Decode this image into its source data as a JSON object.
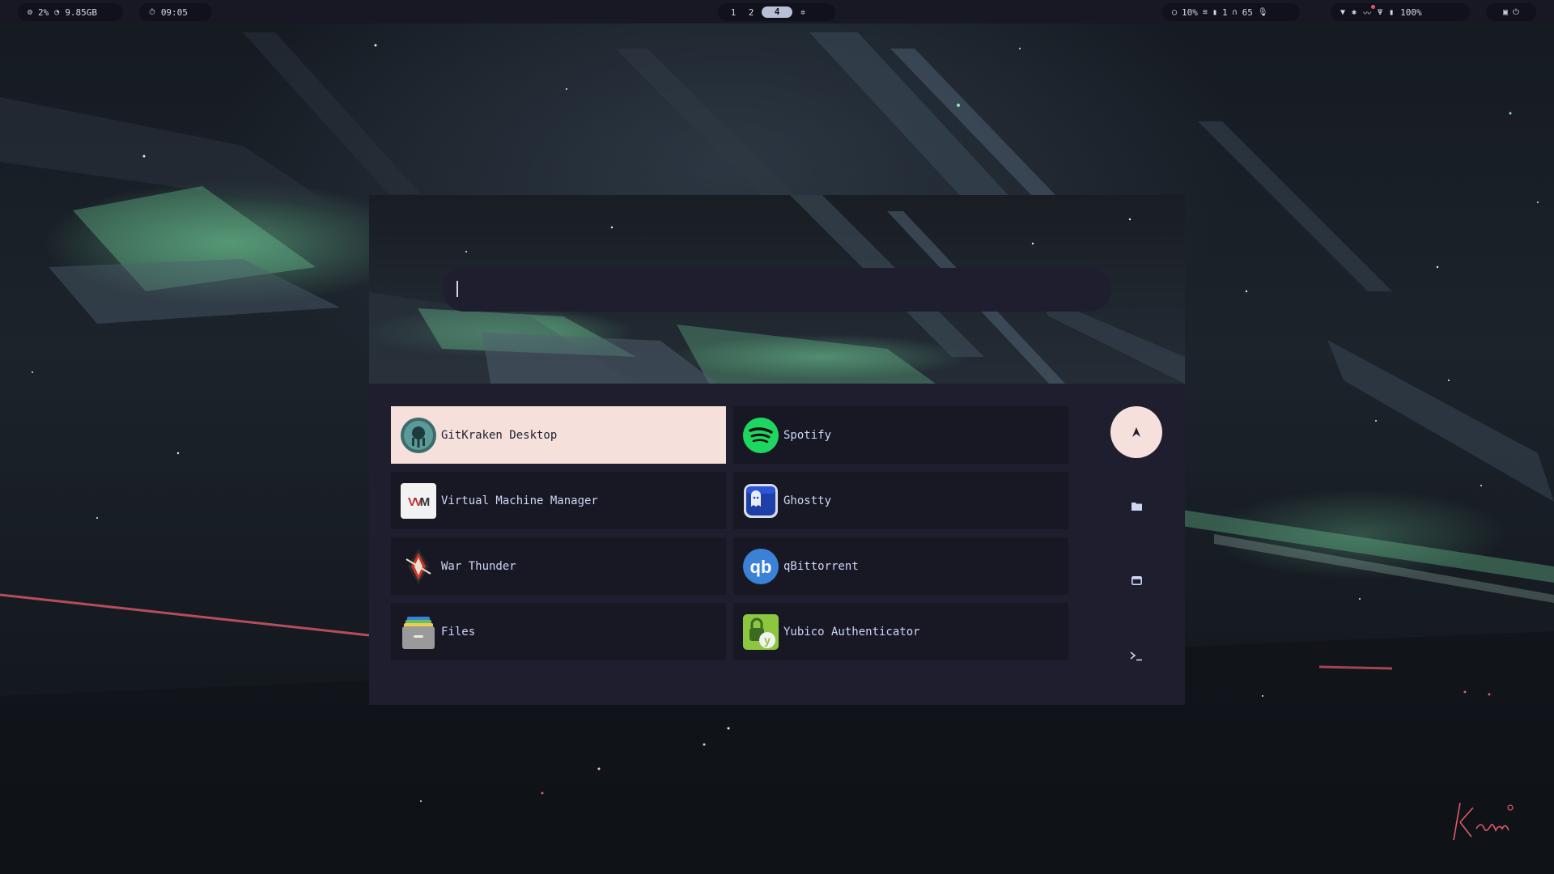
{
  "topbar": {
    "left_pill": {
      "cpu": "2%",
      "memory": "9.85GB"
    },
    "clock_pill": {
      "time": "09:05"
    },
    "workspaces": [
      {
        "label": "1",
        "active": false
      },
      {
        "label": "2",
        "active": false
      },
      {
        "label": "4",
        "active": true
      }
    ],
    "status_pill": {
      "brightness": "10%",
      "network_count": "1",
      "headphone_level": "65"
    },
    "tray_pill": {
      "battery": "100%"
    }
  },
  "launcher": {
    "search": {
      "value": "",
      "placeholder": ""
    },
    "apps": [
      {
        "name": "GitKraken Desktop",
        "icon": "gitkraken-icon",
        "selected": true
      },
      {
        "name": "Spotify",
        "icon": "spotify-icon",
        "selected": false
      },
      {
        "name": "Virtual Machine Manager",
        "icon": "virt-manager-icon",
        "selected": false
      },
      {
        "name": "Ghostty",
        "icon": "ghostty-icon",
        "selected": false
      },
      {
        "name": "War Thunder",
        "icon": "war-thunder-icon",
        "selected": false
      },
      {
        "name": "qBittorrent",
        "icon": "qbittorrent-icon",
        "selected": false
      },
      {
        "name": "Files",
        "icon": "files-icon",
        "selected": false
      },
      {
        "name": "Yubico Authenticator",
        "icon": "yubico-icon",
        "selected": false
      }
    ],
    "modes": [
      {
        "id": "apps",
        "icon": "rocket-icon",
        "active": true
      },
      {
        "id": "files",
        "icon": "folder-icon",
        "active": false
      },
      {
        "id": "windows",
        "icon": "window-icon",
        "active": false
      },
      {
        "id": "run",
        "icon": "terminal-icon",
        "active": false
      }
    ]
  },
  "colors": {
    "surface": "#1e1e2e",
    "mantle": "#181825",
    "crust": "#11111b",
    "accent": "#f5e0dc",
    "text": "#cdd6f4"
  },
  "wallpaper": {
    "signature": "Kenami"
  }
}
